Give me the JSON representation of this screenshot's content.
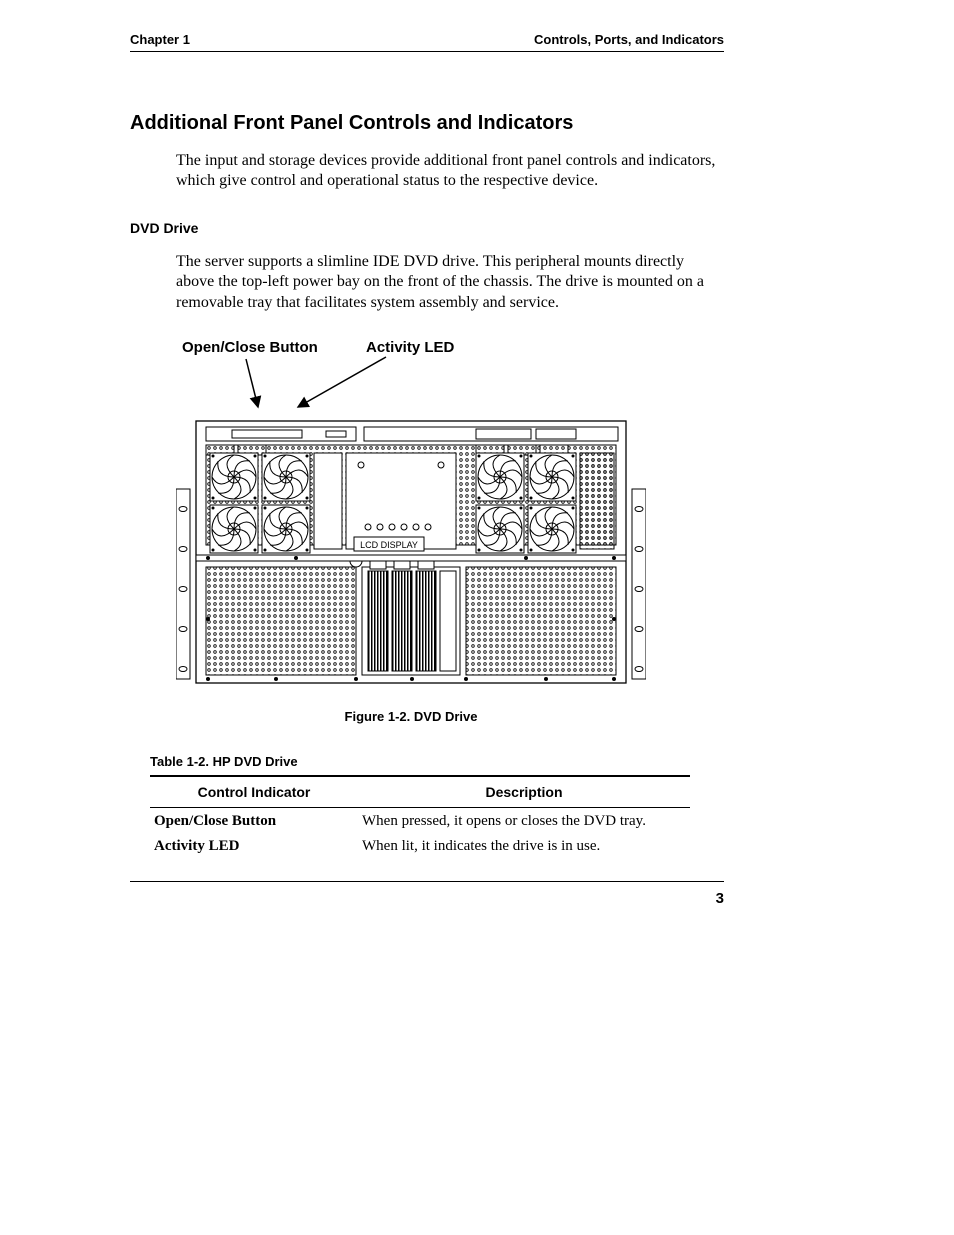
{
  "header": {
    "left": "Chapter 1",
    "right": "Controls, Ports, and Indicators"
  },
  "section": {
    "title": "Additional Front Panel Controls and Indicators",
    "intro": "The input and storage devices provide additional front panel controls and indicators, which give control and operational status to the respective device."
  },
  "subsection": {
    "title": "DVD Drive",
    "body": "The server supports a slimline IDE DVD drive.  This peripheral mounts directly above the top-left power bay on the front of the chassis.  The drive is mounted on a removable tray that facilitates system assembly and service."
  },
  "figure": {
    "callout_open_close": "Open/Close Button",
    "callout_activity": "Activity LED",
    "lcd_label": "LCD DISPLAY",
    "caption": "Figure 1-2. DVD Drive"
  },
  "table": {
    "caption": "Table 1-2. HP DVD Drive",
    "headers": {
      "col1": "Control Indicator",
      "col2": "Description"
    },
    "rows": [
      {
        "indicator": "Open/Close Button",
        "desc": "When pressed, it opens or closes the DVD tray."
      },
      {
        "indicator": "Activity LED",
        "desc": "When lit, it indicates the drive is in use."
      }
    ]
  },
  "footer": {
    "page_number": "3"
  }
}
